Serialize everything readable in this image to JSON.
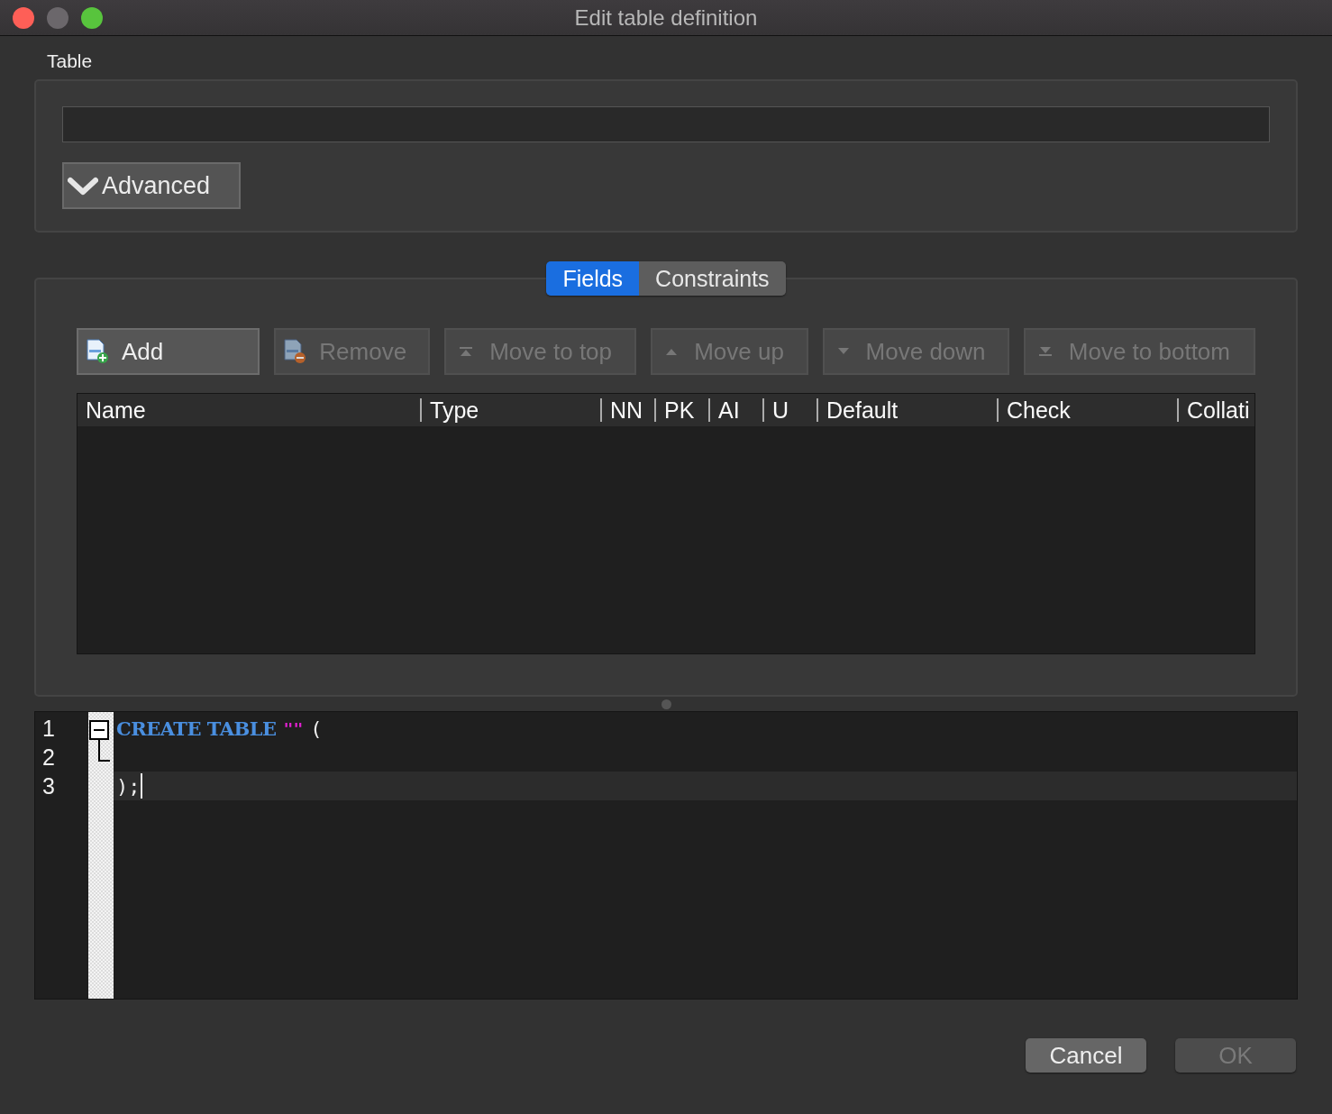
{
  "window": {
    "title": "Edit table definition"
  },
  "table_section": {
    "label": "Table",
    "advanced": {
      "label": "Advanced",
      "expanded": true
    }
  },
  "tabs": [
    {
      "label": "Fields",
      "selected": true
    },
    {
      "label": "Constraints",
      "selected": false
    }
  ],
  "toolbar": [
    {
      "kind": "add",
      "label": "Add",
      "disabled": false
    },
    {
      "kind": "remove",
      "label": "Remove",
      "disabled": true
    },
    {
      "kind": "top",
      "label": "Move to top",
      "disabled": true
    },
    {
      "kind": "up",
      "label": "Move up",
      "disabled": true
    },
    {
      "kind": "down",
      "label": "Move down",
      "disabled": true
    },
    {
      "kind": "bottom",
      "label": "Move to bottom",
      "disabled": true
    }
  ],
  "fields_table": {
    "columns": [
      "Name",
      "Type",
      "NN",
      "PK",
      "AI",
      "U",
      "Default",
      "Check",
      "Collati"
    ]
  },
  "editor": {
    "lines": [
      {
        "number": "1",
        "current": false,
        "tokens": [
          {
            "kind": "keyword",
            "text": "CREATE TABLE"
          },
          {
            "kind": "string",
            "text": "\"\""
          },
          {
            "kind": "plain",
            "text": "("
          }
        ]
      },
      {
        "number": "2",
        "current": false
      },
      {
        "number": "3",
        "current": true,
        "tokens": [
          {
            "kind": "plain",
            "text": ");"
          }
        ]
      }
    ]
  },
  "buttons": [
    {
      "label": "Cancel",
      "disabled": false
    },
    {
      "label": "OK",
      "disabled": true
    }
  ]
}
